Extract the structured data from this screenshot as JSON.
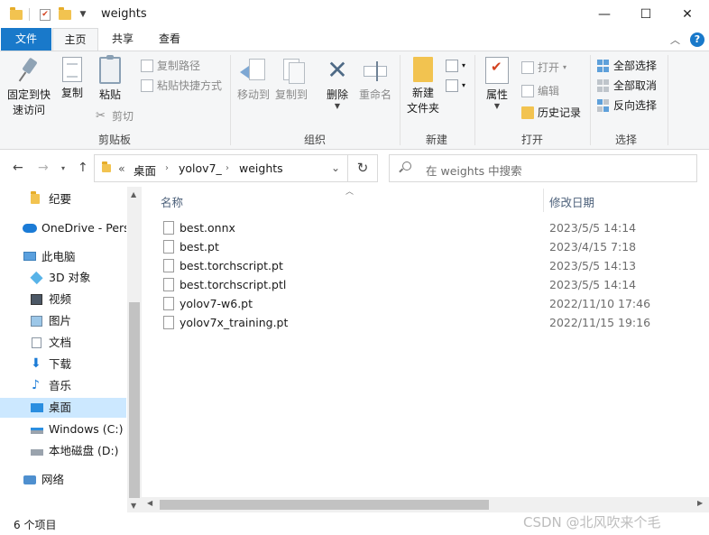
{
  "window": {
    "title": "weights",
    "minimize": "—",
    "maximize": "☐",
    "close": "✕"
  },
  "tabs": {
    "file": "文件",
    "home": "主页",
    "share": "共享",
    "view": "查看",
    "help": "?"
  },
  "ribbon": {
    "clipboard": {
      "label": "剪贴板",
      "pin_line1": "固定到快",
      "pin_line2": "速访问",
      "copy": "复制",
      "paste": "粘贴",
      "copy_path": "复制路径",
      "paste_shortcut": "粘贴快捷方式",
      "cut": "剪切"
    },
    "organize": {
      "label": "组织",
      "move_to": "移动到",
      "copy_to": "复制到",
      "delete": "删除",
      "rename": "重命名"
    },
    "new": {
      "label": "新建",
      "new_folder_line1": "新建",
      "new_folder_line2": "文件夹"
    },
    "open": {
      "label": "打开",
      "properties": "属性",
      "open": "打开",
      "edit": "编辑",
      "history": "历史记录"
    },
    "select": {
      "label": "选择",
      "select_all": "全部选择",
      "select_none": "全部取消",
      "invert": "反向选择"
    }
  },
  "address": {
    "overflow": "«",
    "crumbs": [
      "桌面",
      "yolov7_",
      "weights"
    ],
    "search_placeholder": "在 weights 中搜索"
  },
  "nav_pane": {
    "items": [
      {
        "label": "纪要",
        "icon": "folder-icon"
      },
      {
        "label": "OneDrive - Perso",
        "icon": "cloud-icon"
      },
      {
        "label": "此电脑",
        "icon": "computer-icon"
      },
      {
        "label": "3D 对象",
        "icon": "cube-icon"
      },
      {
        "label": "视频",
        "icon": "video-icon"
      },
      {
        "label": "图片",
        "icon": "picture-icon"
      },
      {
        "label": "文档",
        "icon": "document-icon"
      },
      {
        "label": "下载",
        "icon": "download-icon"
      },
      {
        "label": "音乐",
        "icon": "music-icon"
      },
      {
        "label": "桌面",
        "icon": "desktop-icon"
      },
      {
        "label": "Windows  (C:)",
        "icon": "drive-icon"
      },
      {
        "label": "本地磁盘 (D:)",
        "icon": "drive-icon"
      },
      {
        "label": "网络",
        "icon": "network-icon"
      }
    ],
    "selected": "桌面"
  },
  "file_list": {
    "columns": {
      "name": "名称",
      "date": "修改日期"
    },
    "files": [
      {
        "name": "best.onnx",
        "date": "2023/5/5 14:14"
      },
      {
        "name": "best.pt",
        "date": "2023/4/15 7:18"
      },
      {
        "name": "best.torchscript.pt",
        "date": "2023/5/5 14:13"
      },
      {
        "name": "best.torchscript.ptl",
        "date": "2023/5/5 14:14"
      },
      {
        "name": "yolov7-w6.pt",
        "date": "2022/11/10 17:46"
      },
      {
        "name": "yolov7x_training.pt",
        "date": "2022/11/15 19:16"
      }
    ]
  },
  "status": {
    "count": "6 个项目",
    "watermark": "CSDN @北风吹来个毛"
  },
  "colors": {
    "accent": "#1979ca",
    "selection": "#cce8ff",
    "folder": "#f2c350"
  }
}
